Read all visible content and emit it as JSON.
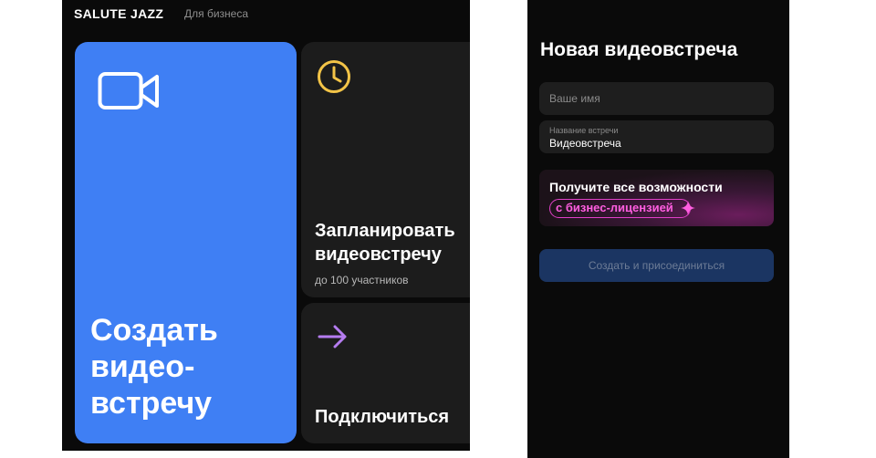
{
  "header": {
    "brand": "SALUTE JAZZ",
    "subtitle": "Для бизнеса"
  },
  "cards": {
    "create": {
      "title": "Создать видео-встречу",
      "icon": "video-camera-icon",
      "color": "#3f7ff4"
    },
    "schedule": {
      "title": "Запланировать\nвидеовстречу",
      "subtitle": "до 100 участников",
      "icon": "clock-icon",
      "icon_color": "#f3c447"
    },
    "join": {
      "title": "Подключиться",
      "icon": "arrow-right-icon",
      "icon_color": "#b57cf0"
    }
  },
  "form": {
    "title": "Новая видеовстреча",
    "name_placeholder": "Ваше имя",
    "meeting_label": "Название встречи",
    "meeting_value": "Видеовстреча",
    "promo_line1": "Получите все возможности",
    "promo_line2": "с бизнес-лицензией",
    "submit_label": "Создать и присоединиться"
  }
}
